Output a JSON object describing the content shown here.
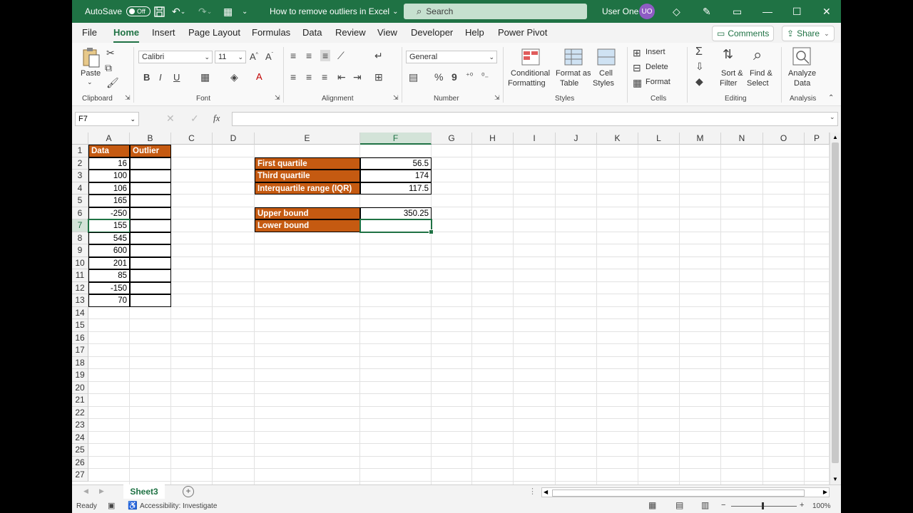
{
  "titlebar": {
    "autosave_label": "AutoSave",
    "autosave_state": "Off",
    "doc_title": "How to remove outliers in Excel",
    "search_placeholder": "Search",
    "user_name": "User One",
    "user_initials": "UO"
  },
  "menu": {
    "tabs": [
      "File",
      "Home",
      "Insert",
      "Page Layout",
      "Formulas",
      "Data",
      "Review",
      "View",
      "Developer",
      "Help",
      "Power Pivot"
    ],
    "comments_label": "Comments",
    "share_label": "Share"
  },
  "ribbon": {
    "clipboard": {
      "paste_label": "Paste",
      "group": "Clipboard"
    },
    "font": {
      "name": "Calibri",
      "size": "11",
      "group": "Font",
      "bold": "B",
      "italic": "I",
      "underline": "U"
    },
    "alignment": {
      "group": "Alignment"
    },
    "number": {
      "format": "General",
      "group": "Number",
      "percent": "%",
      "comma": "9"
    },
    "styles": {
      "conditional_1": "Conditional",
      "conditional_2": "Formatting",
      "format_table_1": "Format as",
      "format_table_2": "Table",
      "cell_styles_1": "Cell",
      "cell_styles_2": "Styles",
      "group": "Styles"
    },
    "cells": {
      "insert": "Insert",
      "delete": "Delete",
      "format": "Format",
      "group": "Cells"
    },
    "editing": {
      "sort_1": "Sort &",
      "sort_2": "Filter",
      "find_1": "Find &",
      "find_2": "Select",
      "group": "Editing"
    },
    "analysis": {
      "analyze_1": "Analyze",
      "analyze_2": "Data",
      "group": "Analysis"
    }
  },
  "formula_bar": {
    "name_box": "F7",
    "fx": "fx",
    "value": ""
  },
  "grid": {
    "columns": [
      "A",
      "B",
      "C",
      "D",
      "E",
      "F",
      "G",
      "H",
      "I",
      "J",
      "K",
      "L",
      "M",
      "N",
      "O",
      "P"
    ],
    "rows": [
      "1",
      "2",
      "3",
      "4",
      "5",
      "6",
      "7",
      "8",
      "9",
      "10",
      "11",
      "12",
      "13",
      "14",
      "15",
      "16",
      "17",
      "18",
      "19",
      "20",
      "21",
      "22",
      "23",
      "24",
      "25",
      "26",
      "27"
    ],
    "selected_column": "F",
    "selected_row": "7",
    "data_header": "Data",
    "outlier_header": "Outlier",
    "data_values": [
      "16",
      "100",
      "106",
      "165",
      "-250",
      "155",
      "545",
      "600",
      "201",
      "85",
      "-150",
      "70"
    ],
    "first_quartile_label": "First quartile",
    "first_quartile_value": "56.5",
    "third_quartile_label": "Third quartile",
    "third_quartile_value": "174",
    "iqr_label": "Interquartile range (IQR)",
    "iqr_value": "117.5",
    "upper_bound_label": "Upper bound",
    "upper_bound_value": "350.25",
    "lower_bound_label": "Lower bound",
    "lower_bound_value": ""
  },
  "sheet_tabs": {
    "active": "Sheet3",
    "add": "+"
  },
  "status": {
    "ready": "Ready",
    "accessibility": "Accessibility: Investigate",
    "zoom": "100%"
  },
  "colors": {
    "excel_green": "#1f7244",
    "header_orange": "#c55a11"
  }
}
